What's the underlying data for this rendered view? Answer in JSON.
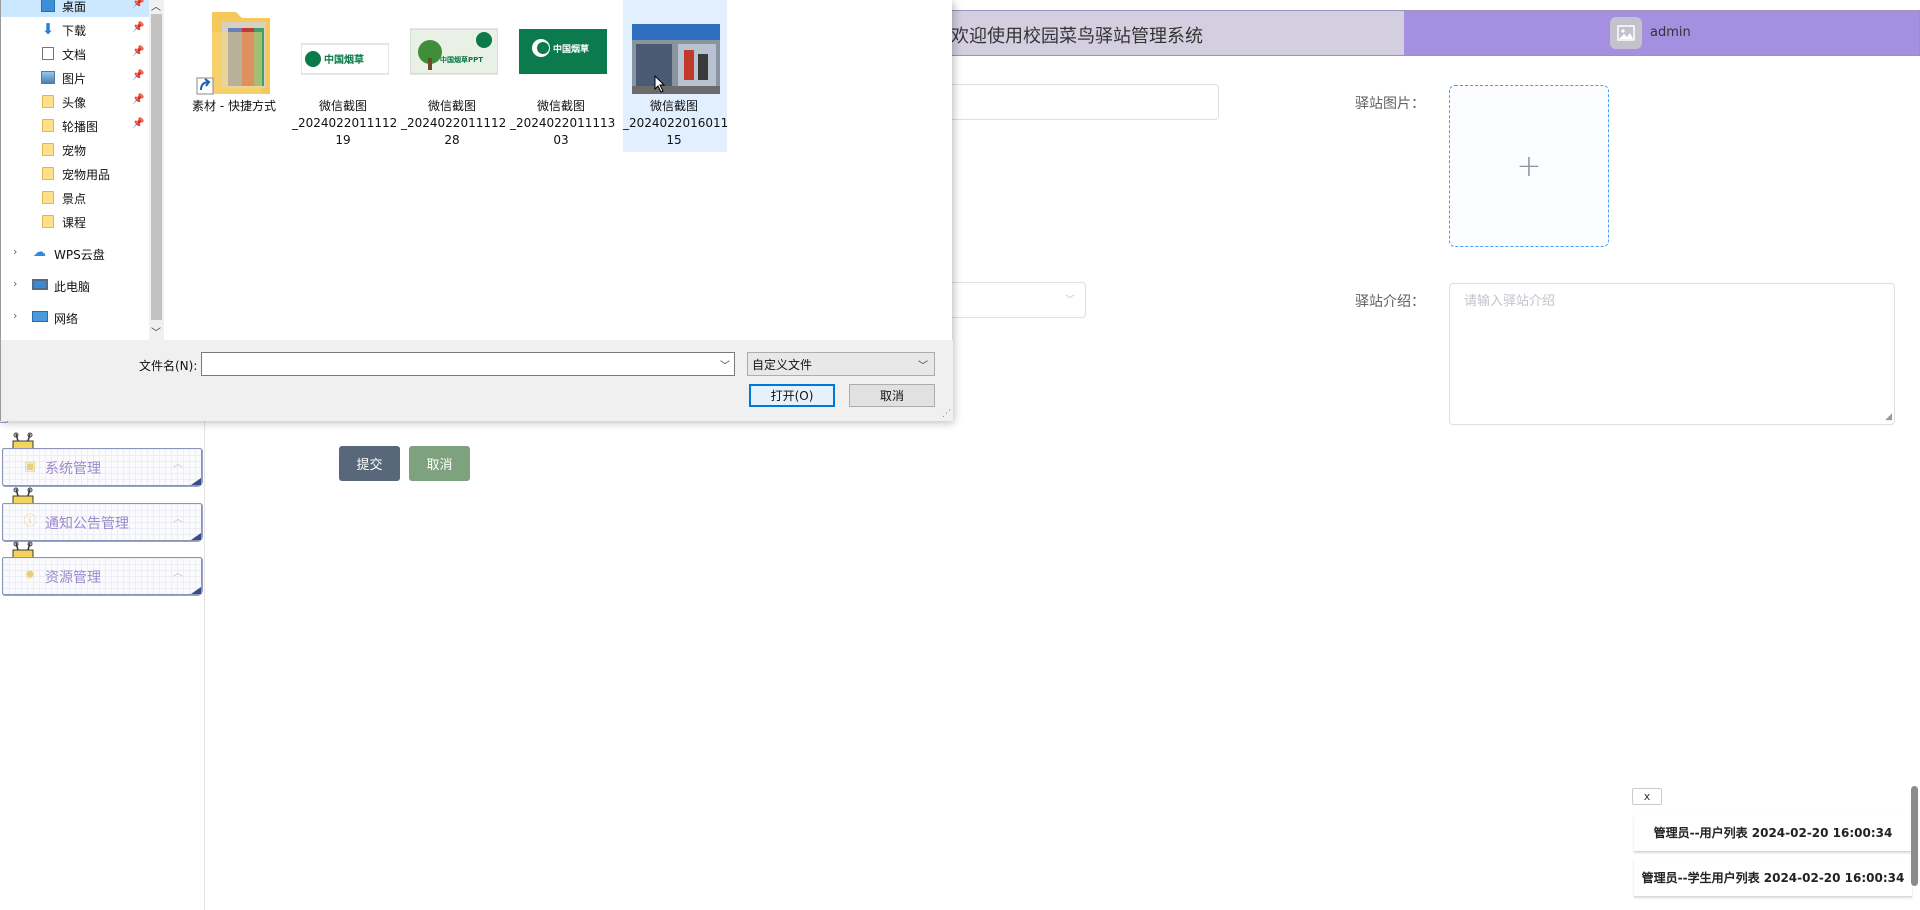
{
  "app": {
    "header_title": "欢迎使用校园菜鸟驿站管理系统",
    "username": "admin",
    "sidebar": [
      {
        "label": "系统管理",
        "icon": "settings-icon"
      },
      {
        "label": "通知公告管理",
        "icon": "info-icon"
      },
      {
        "label": "资源管理",
        "icon": "resource-icon"
      }
    ],
    "form": {
      "image_label": "驿站图片：",
      "intro_label": "驿站介绍：",
      "intro_placeholder": "请输入驿站介绍",
      "upload_plus": "+",
      "submit": "提交",
      "cancel": "取消"
    },
    "history": {
      "close": "x",
      "items": [
        "管理员--用户列表 2024-02-20 16:00:34",
        "管理员--学生用户列表 2024-02-20 16:00:34"
      ]
    }
  },
  "dialog": {
    "nav": [
      {
        "label": "桌面",
        "type": "desktop",
        "pinned": true,
        "selected": true
      },
      {
        "label": "下载",
        "type": "download",
        "pinned": true
      },
      {
        "label": "文档",
        "type": "document",
        "pinned": true
      },
      {
        "label": "图片",
        "type": "picture",
        "pinned": true
      },
      {
        "label": "头像",
        "type": "folder",
        "pinned": true
      },
      {
        "label": "轮播图",
        "type": "folder",
        "pinned": true
      },
      {
        "label": "宠物",
        "type": "folder"
      },
      {
        "label": "宠物用品",
        "type": "folder"
      },
      {
        "label": "景点",
        "type": "folder"
      },
      {
        "label": "课程",
        "type": "folder"
      }
    ],
    "nav_roots": [
      {
        "label": "WPS云盘",
        "icon": "cloud-icon"
      },
      {
        "label": "此电脑",
        "icon": "computer-icon"
      },
      {
        "label": "网络",
        "icon": "network-icon"
      }
    ],
    "files": [
      {
        "line1": "素材 - 快捷方式",
        "line2": "",
        "line3": "",
        "kind": "shortcut-folder"
      },
      {
        "line1": "微信截图",
        "line2": "_2024022011112",
        "line3": "19",
        "kind": "tobacco-white",
        "logo_text": "中国烟草"
      },
      {
        "line1": "微信截图",
        "line2": "_2024022011112",
        "line3": "28",
        "kind": "tobacco-ppt",
        "logo_text": "中国烟草PPT"
      },
      {
        "line1": "微信截图",
        "line2": "_2024022011113",
        "line3": "03",
        "kind": "tobacco-green",
        "logo_text": "中国烟草"
      },
      {
        "line1": "微信截图",
        "line2": "_2024022016011",
        "line3": "15",
        "kind": "storefront-photo",
        "selected": true
      }
    ],
    "filename_label": "文件名(N):",
    "filename_value": "",
    "filter_value": "自定义文件",
    "open_button": "打开(O)",
    "cancel_button": "取消"
  }
}
